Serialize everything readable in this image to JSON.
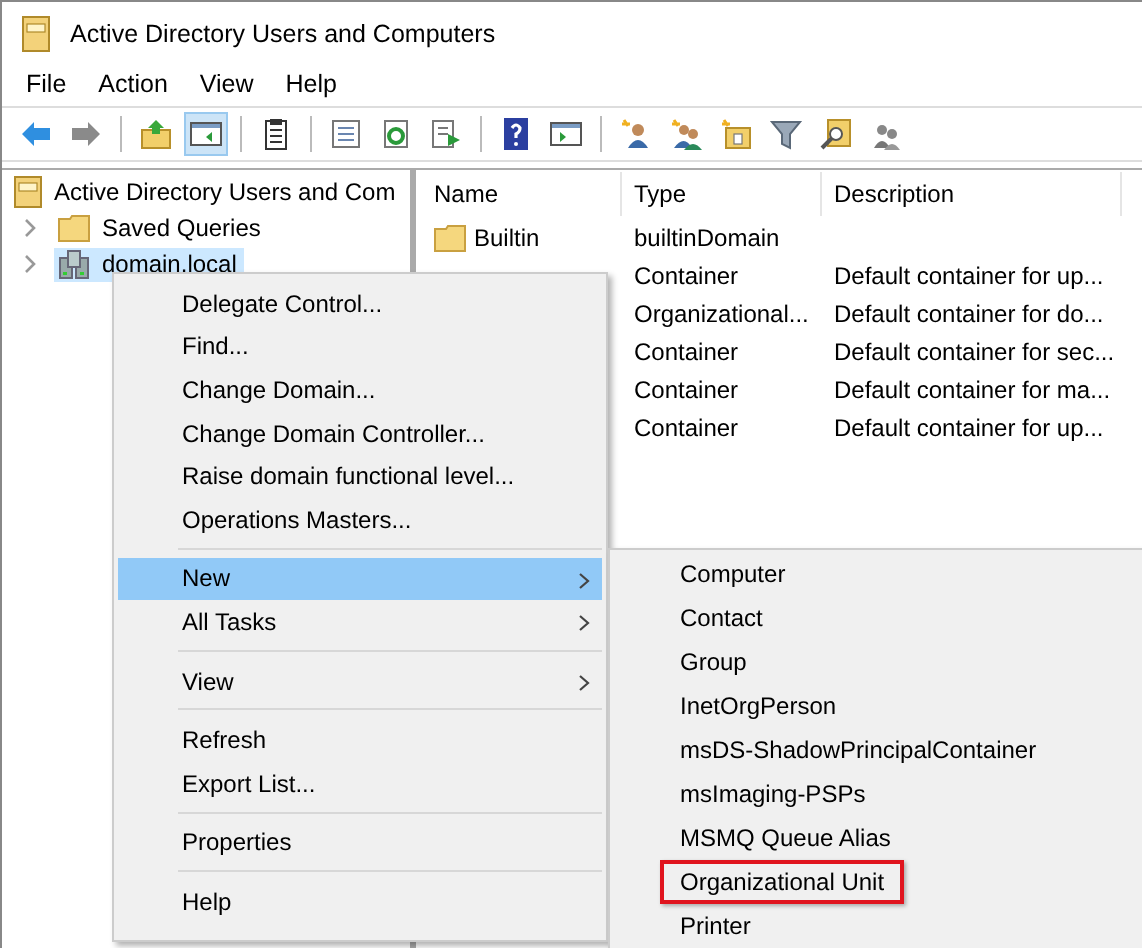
{
  "window": {
    "title": "Active Directory Users and Computers"
  },
  "menu_bar": [
    "File",
    "Action",
    "View",
    "Help"
  ],
  "toolbar": [
    {
      "kind": "back",
      "pressed": false
    },
    {
      "kind": "forward",
      "pressed": false
    },
    {
      "kind": "separator"
    },
    {
      "kind": "up",
      "pressed": false
    },
    {
      "kind": "console-tree",
      "pressed": true
    },
    {
      "kind": "separator"
    },
    {
      "kind": "clipboard",
      "pressed": false
    },
    {
      "kind": "separator"
    },
    {
      "kind": "properties",
      "pressed": false
    },
    {
      "kind": "refresh",
      "pressed": false
    },
    {
      "kind": "export",
      "pressed": false
    },
    {
      "kind": "separator"
    },
    {
      "kind": "help",
      "pressed": false
    },
    {
      "kind": "action-pane",
      "pressed": false
    },
    {
      "kind": "separator"
    },
    {
      "kind": "new-user",
      "pressed": false
    },
    {
      "kind": "new-group",
      "pressed": false
    },
    {
      "kind": "new-ou",
      "pressed": false
    },
    {
      "kind": "filter",
      "pressed": false
    },
    {
      "kind": "find",
      "pressed": false
    },
    {
      "kind": "add-to-group",
      "pressed": false
    }
  ],
  "tree": {
    "label": "Active Directory Users and Com",
    "children": [
      {
        "label": "Saved Queries",
        "kind": "folder",
        "expanded": false,
        "selected": false
      },
      {
        "label": "domain.local",
        "kind": "domain",
        "expanded": false,
        "selected": true
      }
    ]
  },
  "table": {
    "columns": [
      "Name",
      "Type",
      "Description"
    ],
    "rows": [
      {
        "name": "Builtin",
        "type": "builtinDomain"
      },
      {
        "type": "Container",
        "description": "Default container for up..."
      },
      {
        "type": "Organizational...",
        "description": "Default container for do..."
      },
      {
        "type": "Container",
        "description": "Default container for sec..."
      },
      {
        "type": "Container",
        "description": "Default container for ma..."
      },
      {
        "type": "Container",
        "description": "Default container for up..."
      }
    ]
  },
  "context_menu": [
    {
      "kind": "item",
      "label": "Delegate Control...",
      "submenu": false,
      "selected": false
    },
    {
      "kind": "item",
      "label": "Find...",
      "submenu": false,
      "selected": false
    },
    {
      "kind": "item",
      "label": "Change Domain...",
      "submenu": false,
      "selected": false
    },
    {
      "kind": "item",
      "label": "Change Domain Controller...",
      "submenu": false,
      "selected": false
    },
    {
      "kind": "item",
      "label": "Raise domain functional level...",
      "submenu": false,
      "selected": false
    },
    {
      "kind": "item",
      "label": "Operations Masters...",
      "submenu": false,
      "selected": false
    },
    {
      "kind": "separator"
    },
    {
      "kind": "item",
      "label": "New",
      "submenu": true,
      "selected": true
    },
    {
      "kind": "item",
      "label": "All Tasks",
      "submenu": true,
      "selected": false
    },
    {
      "kind": "separator"
    },
    {
      "kind": "item",
      "label": "View",
      "submenu": true,
      "selected": false
    },
    {
      "kind": "separator"
    },
    {
      "kind": "item",
      "label": "Refresh",
      "submenu": false,
      "selected": false
    },
    {
      "kind": "item",
      "label": "Export List...",
      "submenu": false,
      "selected": false
    },
    {
      "kind": "separator"
    },
    {
      "kind": "item",
      "label": "Properties",
      "submenu": false,
      "selected": false
    },
    {
      "kind": "separator"
    },
    {
      "kind": "item",
      "label": "Help",
      "submenu": false,
      "selected": false
    }
  ],
  "submenu": [
    {
      "label": "Computer",
      "highlighted": false
    },
    {
      "label": "Contact",
      "highlighted": false
    },
    {
      "label": "Group",
      "highlighted": false
    },
    {
      "label": "InetOrgPerson",
      "highlighted": false
    },
    {
      "label": "msDS-ShadowPrincipalContainer",
      "highlighted": false
    },
    {
      "label": "msImaging-PSPs",
      "highlighted": false
    },
    {
      "label": "MSMQ Queue Alias",
      "highlighted": false
    },
    {
      "label": "Organizational Unit",
      "highlighted": true
    },
    {
      "label": "Printer",
      "highlighted": false
    }
  ]
}
